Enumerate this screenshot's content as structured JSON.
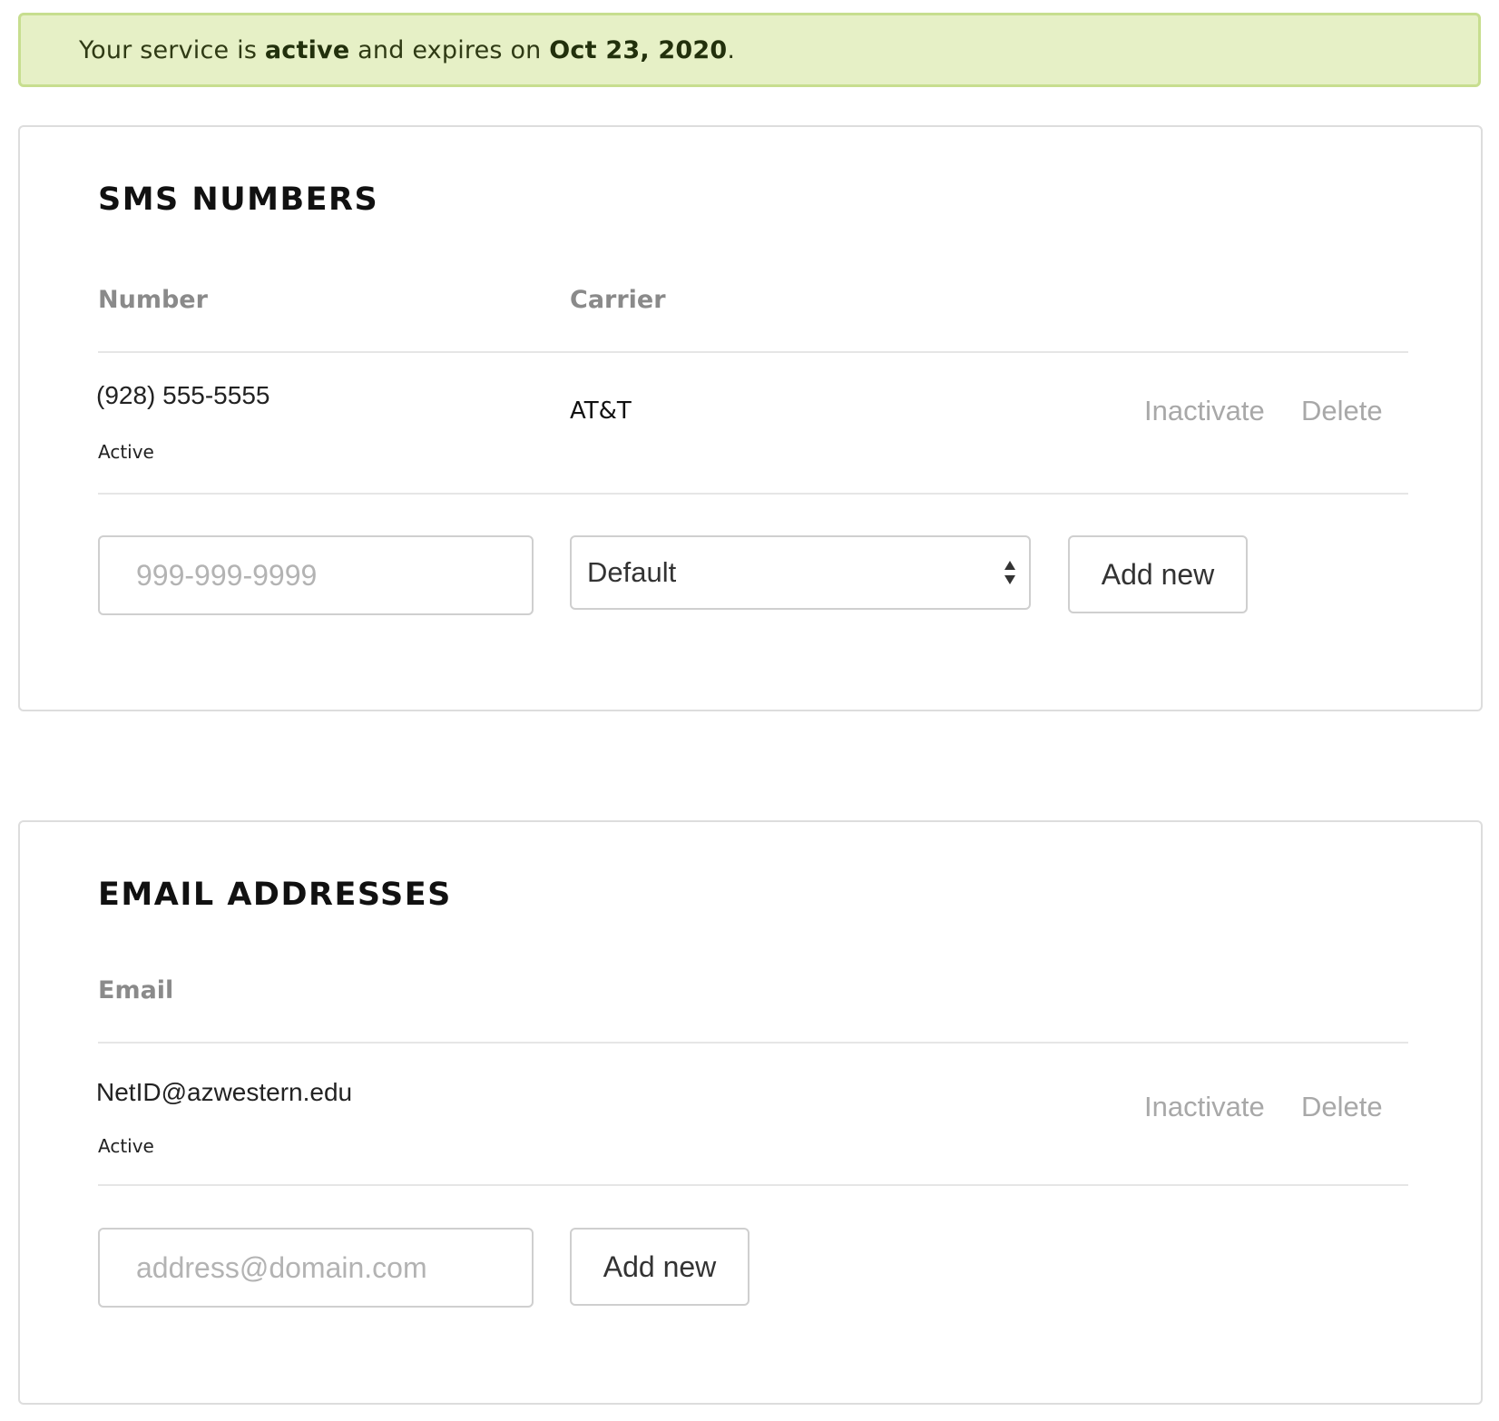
{
  "banner": {
    "prefix": "Your service is ",
    "status": "active",
    "middle": " and expires on ",
    "expires": "Oct 23, 2020",
    "suffix": "."
  },
  "sms": {
    "title": "SMS NUMBERS",
    "columns": {
      "number": "Number",
      "carrier": "Carrier"
    },
    "rows": [
      {
        "number": "(928) 555-5555",
        "status": "Active",
        "carrier": "AT&T",
        "inactivate_label": "Inactivate",
        "delete_label": "Delete"
      }
    ],
    "new_number_placeholder": "999-999-9999",
    "carrier_select_value": "Default",
    "add_label": "Add new"
  },
  "email": {
    "title": "EMAIL ADDRESSES",
    "columns": {
      "email": "Email"
    },
    "rows": [
      {
        "address": "NetID@azwestern.edu",
        "status": "Active",
        "inactivate_label": "Inactivate",
        "delete_label": "Delete"
      }
    ],
    "new_email_placeholder": "address@domain.com",
    "add_label": "Add new"
  }
}
